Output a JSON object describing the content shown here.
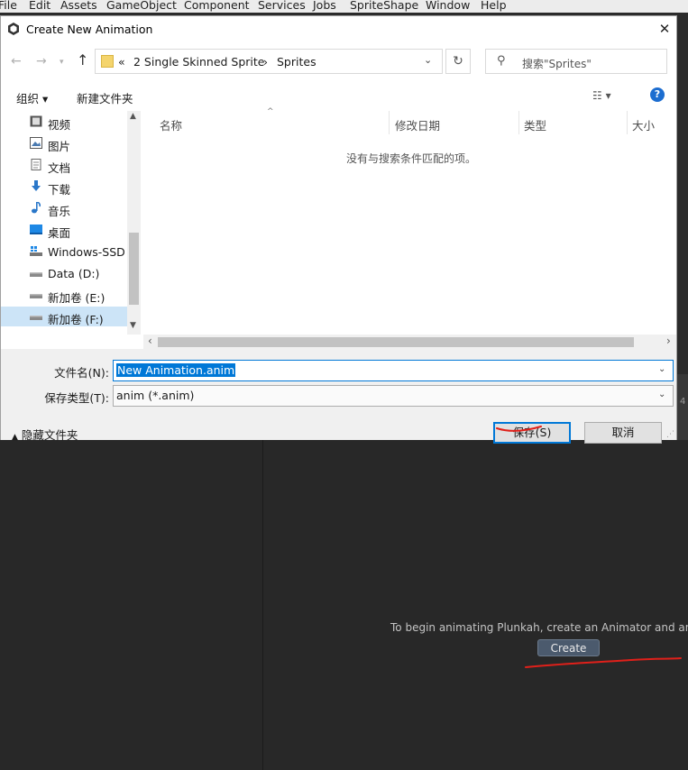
{
  "menubar": {
    "items": [
      "File",
      "Edit",
      "Assets",
      "GameObject",
      "Component",
      "Services",
      "Jobs",
      "SpriteShape",
      "Window",
      "Help"
    ]
  },
  "dialog": {
    "title": "Create New Animation",
    "close_glyph": "✕",
    "address": {
      "overflow": "«",
      "crumbs": [
        "2 Single Skinned Sprite",
        "Sprites"
      ],
      "separator": "›"
    },
    "search_placeholder": "搜索\"Sprites\"",
    "toolbar": {
      "organize": "组织 ▾",
      "new_folder": "新建文件夹",
      "view_glyph": "☷ ▾",
      "help_glyph": "?"
    },
    "nav_items": [
      {
        "label": "视频",
        "icon": "video-icon"
      },
      {
        "label": "图片",
        "icon": "pictures-icon"
      },
      {
        "label": "文档",
        "icon": "documents-icon"
      },
      {
        "label": "下载",
        "icon": "downloads-icon"
      },
      {
        "label": "音乐",
        "icon": "music-icon"
      },
      {
        "label": "桌面",
        "icon": "desktop-icon"
      },
      {
        "label": "Windows-SSD",
        "icon": "system-drive-icon"
      },
      {
        "label": "Data (D:)",
        "icon": "drive-icon"
      },
      {
        "label": "新加卷 (E:)",
        "icon": "drive-icon"
      },
      {
        "label": "新加卷 (F:)",
        "icon": "drive-icon"
      }
    ],
    "columns": [
      "名称",
      "修改日期",
      "类型",
      "大小"
    ],
    "empty_message": "没有与搜索条件匹配的项。",
    "filename_label": "文件名(N):",
    "filename_value": "New Animation.anim",
    "filetype_label": "保存类型(T):",
    "filetype_value": "anim (*.anim)",
    "hide_folders": "隐藏文件夹",
    "save_button": "保存(S)",
    "cancel_button": "取消"
  },
  "unity": {
    "message": "To begin animating Plunkah, create an Animator and an Ani",
    "create_button": "Create",
    "side_number": "4"
  },
  "colors": {
    "accent": "#0078d7",
    "annotation": "#e0201a",
    "unity_bg": "#282828"
  }
}
